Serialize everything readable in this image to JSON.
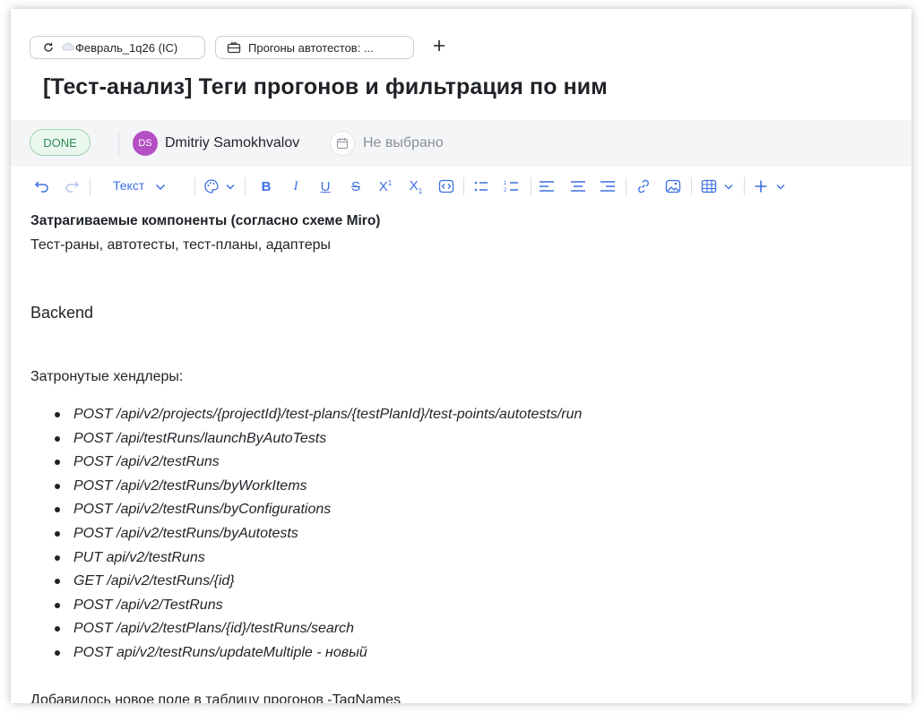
{
  "tabs": [
    {
      "label": "Февраль_1q26 (IC)",
      "icon": "sprint-icon"
    },
    {
      "label": "Прогоны автотестов: ...",
      "icon": "briefcase-icon"
    }
  ],
  "add_tab_icon": "plus-icon",
  "page_title": "[Тест-анализ] Теги прогонов и фильтрация по ним",
  "status": {
    "badge": "DONE",
    "assignee_initials": "DS",
    "assignee_name": "Dmitriy Samokhvalov",
    "date_placeholder": "Не выбрано"
  },
  "toolbar": {
    "text_style": "Текст"
  },
  "content": {
    "components_heading": "Затрагиваемые компоненты (согласно схеме Miro)",
    "components_list": "Тест-раны, автотесты, тест-планы, адаптеры",
    "backend_heading": "Backend",
    "handlers_label": "Затронутые хендлеры:",
    "handlers": [
      "POST /api/v2/projects/{projectId}/test-plans/{testPlanId}/test-points/autotests/run",
      "POST /api/testRuns/launchByAutoTests",
      "POST /api/v2/testRuns",
      "POST /api/v2/testRuns/byWorkItems",
      "POST /api/v2/testRuns/byConfigurations",
      "POST /api/v2/testRuns/byAutotests",
      "PUT api/v2/testRuns",
      "GET /api/v2/testRuns/{id}",
      "POST /api/v2/TestRuns",
      "POST /api/v2/testPlans/{id}/testRuns/search",
      "POST api/v2/testRuns/updateMultiple - новый"
    ],
    "added_field": "Добавилось новое поле в таблицу прогонов -TagNames"
  },
  "colors": {
    "accent": "#3d6fe3",
    "done_green": "#2e8b57",
    "avatar": "#b44fc4"
  }
}
